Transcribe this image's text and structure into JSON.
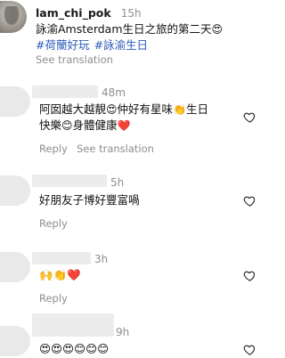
{
  "main_comment": {
    "username": "lam_chi_pok",
    "time": "15h",
    "text": "詠渝Amsterdam生日之旅的第二天",
    "text_emoji": "😍",
    "hashtags": [
      "#荷蘭好玩",
      "#詠渝生日"
    ],
    "see_translation": "See translation"
  },
  "replies": [
    {
      "time": "48m",
      "line1": "阿囡越大越靚",
      "line1_emoji": "😍",
      "line1b": "仲好有星味",
      "line1b_emoji": "👏",
      "line1c": "生日",
      "line2a": "快樂",
      "line2_emoji": "😊",
      "line2b": "身體健康",
      "line2_heart": "❤️",
      "reply_label": "Reply",
      "see_translation": "See translation"
    },
    {
      "time": "5h",
      "text": "好朋友子博好豐富喎",
      "reply_label": "Reply"
    },
    {
      "time": "3h",
      "emojis": "🙌👏❤️",
      "reply_label": "Reply"
    },
    {
      "time": "9h",
      "emojis": "😍😍😍😊😊😊"
    }
  ],
  "icons": {
    "like": "heart-outline-icon"
  },
  "colors": {
    "hashtag": "#2a5bb8",
    "meta": "#8e8e8e"
  }
}
